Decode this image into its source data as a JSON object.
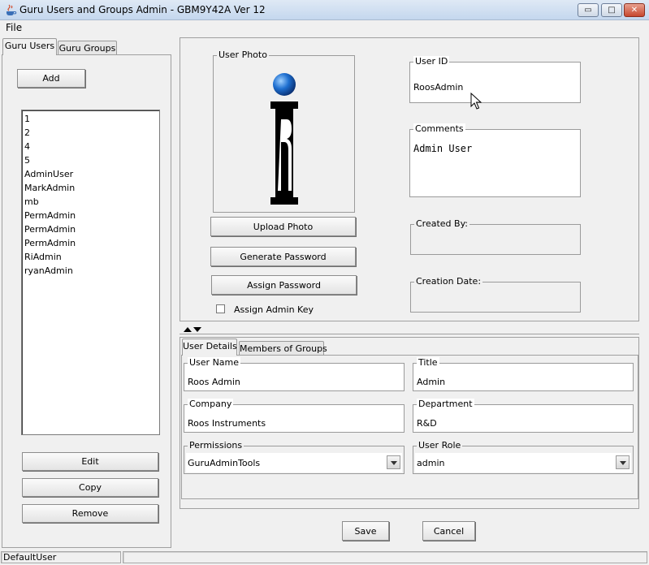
{
  "window": {
    "title": "Guru Users and Groups Admin  - GBM9Y42A Ver 12",
    "min_glyph": "▭",
    "max_glyph": "□",
    "close_glyph": "✕"
  },
  "menu": {
    "file": "File"
  },
  "left_tabs": {
    "users": "Guru Users",
    "groups": "Guru Groups"
  },
  "left_panel": {
    "add_label": "Add",
    "users": [
      "1",
      "2",
      "4",
      "5",
      "AdminUser",
      "MarkAdmin",
      "mb",
      "PermAdmin",
      "PermAdmin",
      "PermAdmin",
      "RiAdmin",
      "ryanAdmin"
    ],
    "edit_label": "Edit",
    "copy_label": "Copy",
    "remove_label": "Remove"
  },
  "user_panel": {
    "photo_label": "User Photo",
    "upload_label": "Upload Photo",
    "generate_label": "Generate Password",
    "assign_label": "Assign Password",
    "admin_key_label": "Assign Admin Key",
    "admin_key_checked": false,
    "user_id_label": "User ID",
    "user_id_value": "RoosAdmin",
    "comments_label": "Comments",
    "comments_value": "Admin User",
    "created_by_label": "Created By:",
    "created_by_value": "",
    "creation_date_label": "Creation Date:",
    "creation_date_value": ""
  },
  "detail_tabs": {
    "details": "User Details",
    "members": "Members of Groups"
  },
  "details": {
    "user_name_label": "User Name",
    "user_name_value": "Roos Admin",
    "title_label": "Title",
    "title_value": "Admin",
    "company_label": "Company",
    "company_value": "Roos Instruments",
    "department_label": "Department",
    "department_value": "R&D",
    "permissions_label": "Permissions",
    "permissions_value": "GuruAdminTools",
    "role_label": "User Role",
    "role_value": "admin"
  },
  "actions": {
    "save_label": "Save",
    "cancel_label": "Cancel"
  },
  "status": {
    "user": "DefaultUser",
    "message": ""
  }
}
